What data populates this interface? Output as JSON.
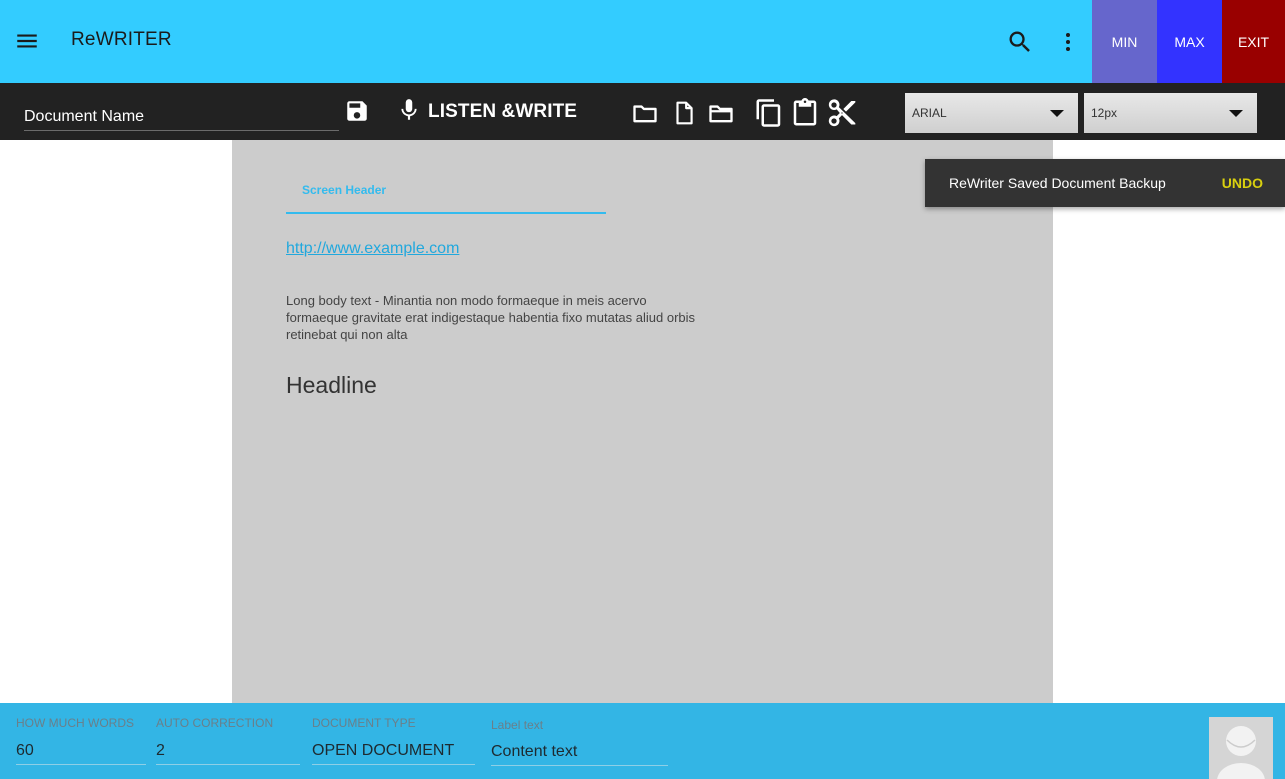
{
  "app": {
    "title": "ReWRITER"
  },
  "window_controls": {
    "min": "MIN",
    "max": "MAX",
    "exit": "EXIT"
  },
  "toolbar": {
    "document_name_placeholder": "Document Name",
    "listen_write_label": "LISTEN &WRITE",
    "font_select": {
      "value": "ARIAL"
    },
    "size_select": {
      "value": "12px"
    },
    "icons": [
      "save-icon",
      "microphone-icon",
      "folder-icon",
      "new-file-icon",
      "folder-open-icon",
      "copy-icon",
      "paste-icon",
      "cut-icon"
    ]
  },
  "document": {
    "screen_header": "Screen Header",
    "link": "http://www.example.com",
    "body_text": "Long body text - Minantia non modo formaeque in meis acervo formaeque gravitate erat indigestaque habentia fixo mutatas aliud orbis retinebat qui non alta",
    "headline": "Headline"
  },
  "snackbar": {
    "message": "ReWriter Saved Document Backup",
    "action": "UNDO"
  },
  "bottom_fields": [
    {
      "label": "HOW MUCH WORDS",
      "value": "60"
    },
    {
      "label": "AUTO CORRECTION",
      "value": "2"
    },
    {
      "label": "DOCUMENT TYPE",
      "value": "OPEN DOCUMENT"
    },
    {
      "label": "Label text",
      "value": "Content text"
    }
  ],
  "colors": {
    "appbar": "#33ccff",
    "toolbar": "#222222",
    "min_button": "#6666cc",
    "max_button": "#3333ff",
    "exit_button": "#990000",
    "bottombar": "#33b5e5",
    "accent": "#33bbee",
    "undo": "#d8cf0f"
  }
}
